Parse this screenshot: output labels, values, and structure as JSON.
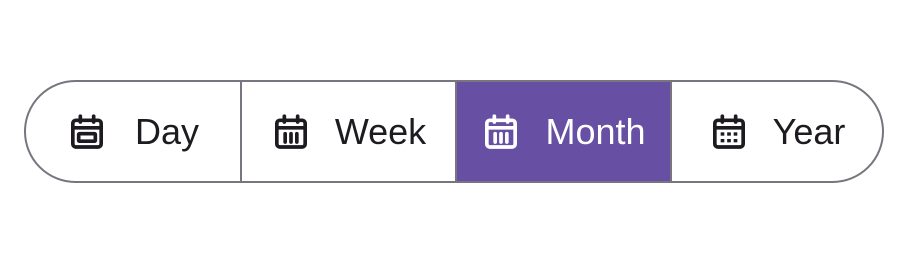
{
  "segmented_control": {
    "selected": "Month",
    "accent_color": "#6750a4",
    "outline_color": "#79747e",
    "segments": [
      {
        "label": "Day",
        "icon": "calendar-day-icon",
        "selected": false
      },
      {
        "label": "Week",
        "icon": "calendar-week-icon",
        "selected": false
      },
      {
        "label": "Month",
        "icon": "calendar-month-icon",
        "selected": true
      },
      {
        "label": "Year",
        "icon": "calendar-year-icon",
        "selected": false
      }
    ]
  }
}
